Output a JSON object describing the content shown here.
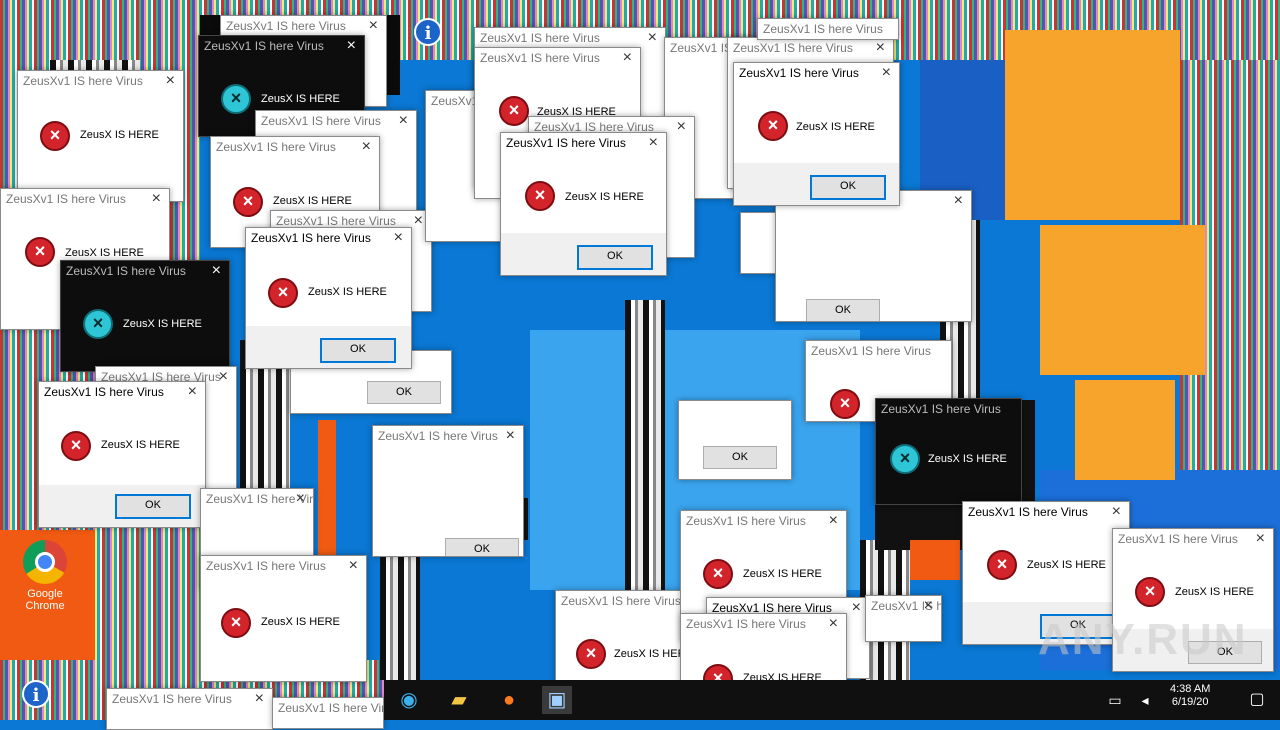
{
  "dialog": {
    "title": "ZeusXv1 IS here Virus",
    "title_active": "ZeusXv1 IS here Virus",
    "message": "ZeusX IS HERE",
    "ok_label": "OK",
    "close_glyph": "×",
    "error_icon": "error-x-icon"
  },
  "desktop": {
    "chrome_label": "Google Chrome",
    "info_glyph": "i"
  },
  "taskbar": {
    "time": "4:38 AM",
    "date": "6/19/20"
  },
  "watermark": "ANY.RUN",
  "colors": {
    "error_red": "#d3242c",
    "desktop_blue": "#0a78d4",
    "accent_orange": "#f7a42c"
  }
}
